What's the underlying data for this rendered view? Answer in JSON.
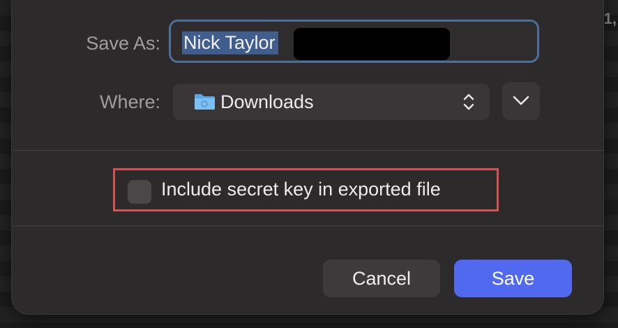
{
  "background": {
    "partial_text": "1,"
  },
  "dialog": {
    "save_as_label": "Save As:",
    "filename_value": "Nick Taylor",
    "where_label": "Where:",
    "where_value": "Downloads",
    "where_icon": "folder-icon",
    "expand_icon": "chevron-down-icon",
    "checkbox_label": "Include secret key in exported file",
    "checkbox_checked": false,
    "cancel_label": "Cancel",
    "save_label": "Save"
  },
  "colors": {
    "dialog_bg": "#2d2a2c",
    "selection": "#3f5e8d",
    "focus_ring": "#4d6f99",
    "primary_button": "#5169ee",
    "highlight_box": "#d45452"
  }
}
